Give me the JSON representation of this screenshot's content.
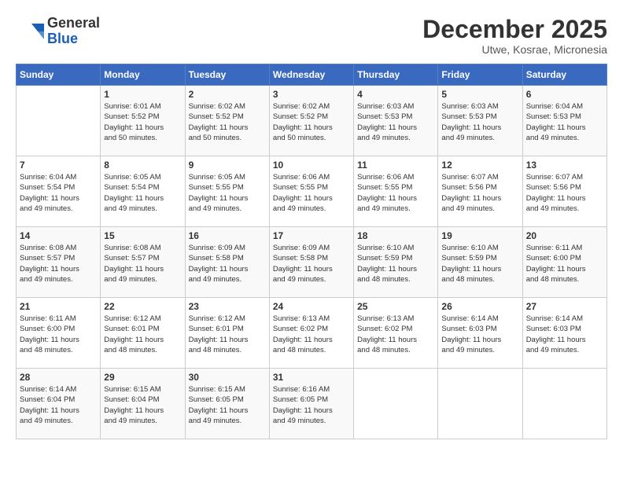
{
  "logo": {
    "general": "General",
    "blue": "Blue"
  },
  "title": {
    "month": "December 2025",
    "location": "Utwe, Kosrae, Micronesia"
  },
  "weekdays": [
    "Sunday",
    "Monday",
    "Tuesday",
    "Wednesday",
    "Thursday",
    "Friday",
    "Saturday"
  ],
  "weeks": [
    [
      {
        "day": "",
        "info": ""
      },
      {
        "day": "1",
        "info": "Sunrise: 6:01 AM\nSunset: 5:52 PM\nDaylight: 11 hours\nand 50 minutes."
      },
      {
        "day": "2",
        "info": "Sunrise: 6:02 AM\nSunset: 5:52 PM\nDaylight: 11 hours\nand 50 minutes."
      },
      {
        "day": "3",
        "info": "Sunrise: 6:02 AM\nSunset: 5:52 PM\nDaylight: 11 hours\nand 50 minutes."
      },
      {
        "day": "4",
        "info": "Sunrise: 6:03 AM\nSunset: 5:53 PM\nDaylight: 11 hours\nand 49 minutes."
      },
      {
        "day": "5",
        "info": "Sunrise: 6:03 AM\nSunset: 5:53 PM\nDaylight: 11 hours\nand 49 minutes."
      },
      {
        "day": "6",
        "info": "Sunrise: 6:04 AM\nSunset: 5:53 PM\nDaylight: 11 hours\nand 49 minutes."
      }
    ],
    [
      {
        "day": "7",
        "info": "Sunrise: 6:04 AM\nSunset: 5:54 PM\nDaylight: 11 hours\nand 49 minutes."
      },
      {
        "day": "8",
        "info": "Sunrise: 6:05 AM\nSunset: 5:54 PM\nDaylight: 11 hours\nand 49 minutes."
      },
      {
        "day": "9",
        "info": "Sunrise: 6:05 AM\nSunset: 5:55 PM\nDaylight: 11 hours\nand 49 minutes."
      },
      {
        "day": "10",
        "info": "Sunrise: 6:06 AM\nSunset: 5:55 PM\nDaylight: 11 hours\nand 49 minutes."
      },
      {
        "day": "11",
        "info": "Sunrise: 6:06 AM\nSunset: 5:55 PM\nDaylight: 11 hours\nand 49 minutes."
      },
      {
        "day": "12",
        "info": "Sunrise: 6:07 AM\nSunset: 5:56 PM\nDaylight: 11 hours\nand 49 minutes."
      },
      {
        "day": "13",
        "info": "Sunrise: 6:07 AM\nSunset: 5:56 PM\nDaylight: 11 hours\nand 49 minutes."
      }
    ],
    [
      {
        "day": "14",
        "info": "Sunrise: 6:08 AM\nSunset: 5:57 PM\nDaylight: 11 hours\nand 49 minutes."
      },
      {
        "day": "15",
        "info": "Sunrise: 6:08 AM\nSunset: 5:57 PM\nDaylight: 11 hours\nand 49 minutes."
      },
      {
        "day": "16",
        "info": "Sunrise: 6:09 AM\nSunset: 5:58 PM\nDaylight: 11 hours\nand 49 minutes."
      },
      {
        "day": "17",
        "info": "Sunrise: 6:09 AM\nSunset: 5:58 PM\nDaylight: 11 hours\nand 49 minutes."
      },
      {
        "day": "18",
        "info": "Sunrise: 6:10 AM\nSunset: 5:59 PM\nDaylight: 11 hours\nand 48 minutes."
      },
      {
        "day": "19",
        "info": "Sunrise: 6:10 AM\nSunset: 5:59 PM\nDaylight: 11 hours\nand 48 minutes."
      },
      {
        "day": "20",
        "info": "Sunrise: 6:11 AM\nSunset: 6:00 PM\nDaylight: 11 hours\nand 48 minutes."
      }
    ],
    [
      {
        "day": "21",
        "info": "Sunrise: 6:11 AM\nSunset: 6:00 PM\nDaylight: 11 hours\nand 48 minutes."
      },
      {
        "day": "22",
        "info": "Sunrise: 6:12 AM\nSunset: 6:01 PM\nDaylight: 11 hours\nand 48 minutes."
      },
      {
        "day": "23",
        "info": "Sunrise: 6:12 AM\nSunset: 6:01 PM\nDaylight: 11 hours\nand 48 minutes."
      },
      {
        "day": "24",
        "info": "Sunrise: 6:13 AM\nSunset: 6:02 PM\nDaylight: 11 hours\nand 48 minutes."
      },
      {
        "day": "25",
        "info": "Sunrise: 6:13 AM\nSunset: 6:02 PM\nDaylight: 11 hours\nand 48 minutes."
      },
      {
        "day": "26",
        "info": "Sunrise: 6:14 AM\nSunset: 6:03 PM\nDaylight: 11 hours\nand 49 minutes."
      },
      {
        "day": "27",
        "info": "Sunrise: 6:14 AM\nSunset: 6:03 PM\nDaylight: 11 hours\nand 49 minutes."
      }
    ],
    [
      {
        "day": "28",
        "info": "Sunrise: 6:14 AM\nSunset: 6:04 PM\nDaylight: 11 hours\nand 49 minutes."
      },
      {
        "day": "29",
        "info": "Sunrise: 6:15 AM\nSunset: 6:04 PM\nDaylight: 11 hours\nand 49 minutes."
      },
      {
        "day": "30",
        "info": "Sunrise: 6:15 AM\nSunset: 6:05 PM\nDaylight: 11 hours\nand 49 minutes."
      },
      {
        "day": "31",
        "info": "Sunrise: 6:16 AM\nSunset: 6:05 PM\nDaylight: 11 hours\nand 49 minutes."
      },
      {
        "day": "",
        "info": ""
      },
      {
        "day": "",
        "info": ""
      },
      {
        "day": "",
        "info": ""
      }
    ]
  ]
}
